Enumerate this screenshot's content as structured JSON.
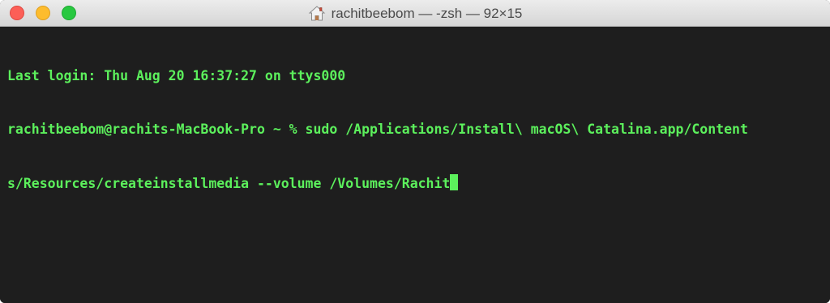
{
  "window": {
    "title": "rachitbeebom — -zsh — 92×15"
  },
  "terminal": {
    "lines": [
      "Last login: Thu Aug 20 16:37:27 on ttys000",
      "rachitbeebom@rachits-MacBook-Pro ~ % sudo /Applications/Install\\ macOS\\ Catalina.app/Content",
      "s/Resources/createinstallmedia --volume /Volumes/Rachit"
    ],
    "text_color": "#5cf05c",
    "background_color": "#1e1e1e"
  },
  "icons": {
    "title_icon": "home-icon"
  }
}
